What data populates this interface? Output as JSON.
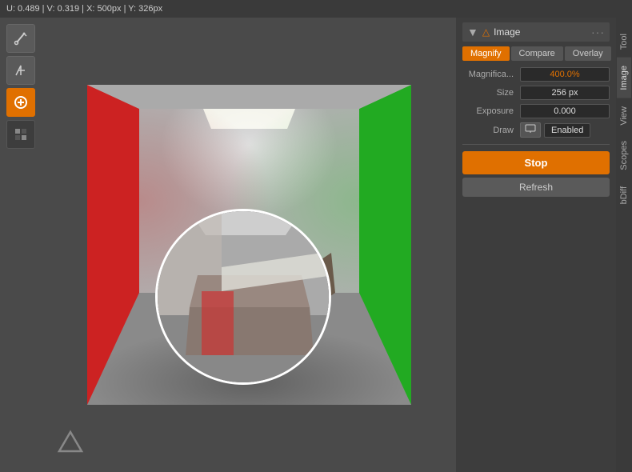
{
  "statusbar": {
    "text": "U: 0.489 | V: 0.319 | X: 500px | Y: 326px"
  },
  "toolbar": {
    "tools": [
      {
        "name": "eyedropper",
        "icon": "✚",
        "active": false
      },
      {
        "name": "brush",
        "icon": "⌁",
        "active": false
      },
      {
        "name": "render-slot",
        "icon": "◎",
        "active": true
      },
      {
        "name": "checker",
        "icon": "▦",
        "active": false
      }
    ]
  },
  "panel": {
    "section_title": "Image",
    "section_icon": "△",
    "tabs": [
      {
        "label": "Magnify",
        "active": true
      },
      {
        "label": "Compare",
        "active": false
      },
      {
        "label": "Overlay",
        "active": false
      }
    ],
    "properties": {
      "magnification_label": "Magnifica...",
      "magnification_value": "400.0%",
      "size_label": "Size",
      "size_value": "256 px",
      "exposure_label": "Exposure",
      "exposure_value": "0.000",
      "draw_label": "Draw",
      "draw_enabled": "Enabled"
    },
    "buttons": {
      "stop": "Stop",
      "refresh": "Refresh"
    }
  },
  "side_tabs": [
    {
      "label": "Tool",
      "active": false
    },
    {
      "label": "Image",
      "active": true
    },
    {
      "label": "View",
      "active": false
    },
    {
      "label": "Scopes",
      "active": false
    },
    {
      "label": "bDiff",
      "active": false
    }
  ]
}
